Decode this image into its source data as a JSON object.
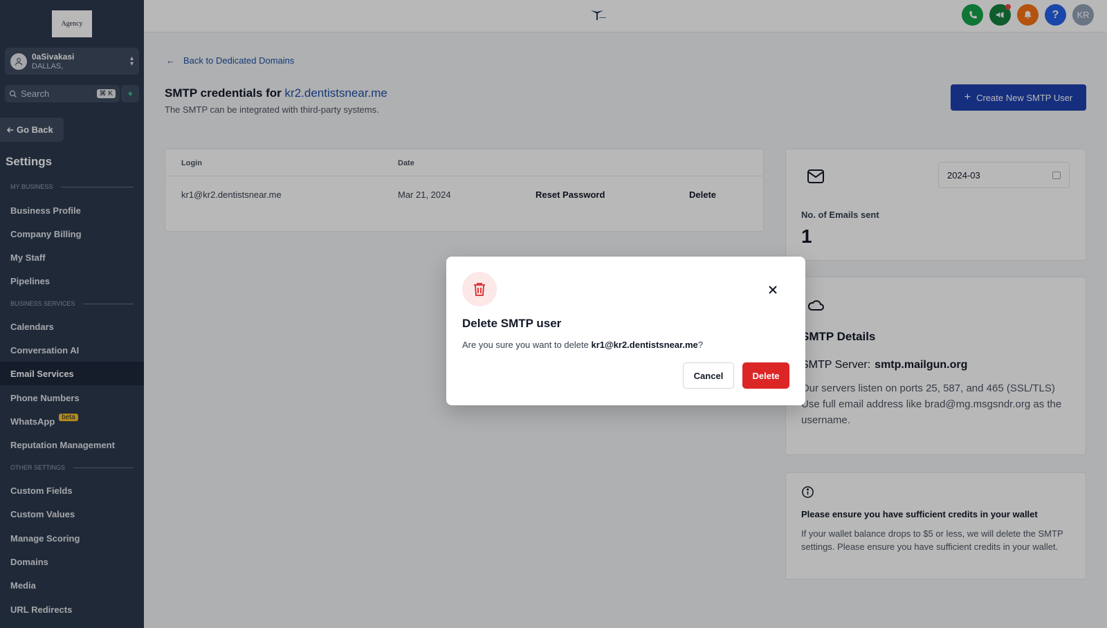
{
  "sidebar": {
    "logo_text": "Agency",
    "location": {
      "name": "0aSivakasi",
      "city": "DALLAS,"
    },
    "search": {
      "label": "Search",
      "shortcut": "⌘ K"
    },
    "go_back": "Go Back",
    "settings_title": "Settings",
    "sections": {
      "my_business": "MY BUSINESS",
      "business_services": "BUSINESS SERVICES",
      "other_settings": "OTHER SETTINGS"
    },
    "items": {
      "business_profile": "Business Profile",
      "company_billing": "Company Billing",
      "my_staff": "My Staff",
      "pipelines": "Pipelines",
      "calendars": "Calendars",
      "conversation_ai": "Conversation AI",
      "email_services": "Email Services",
      "phone_numbers": "Phone Numbers",
      "whatsapp": "WhatsApp",
      "whatsapp_badge": "beta",
      "reputation_management": "Reputation Management",
      "custom_fields": "Custom Fields",
      "custom_values": "Custom Values",
      "manage_scoring": "Manage Scoring",
      "domains": "Domains",
      "media": "Media",
      "url_redirects": "URL Redirects"
    }
  },
  "topbar": {
    "icons": [
      "phone-icon",
      "megaphone-icon",
      "bell-icon",
      "help-icon"
    ],
    "help_glyph": "?",
    "avatar_initials": "KR",
    "colors": {
      "phone": "#16a34a",
      "megaphone": "#15803d",
      "bell": "#f97316",
      "help": "#2563eb",
      "avatar": "#94a3b8"
    }
  },
  "main": {
    "back_link": "Back to Dedicated Domains",
    "title_prefix": "SMTP credentials for",
    "title_domain": "kr2.dentistsnear.me",
    "subtitle": "The SMTP can be integrated with third-party systems.",
    "create_button": "Create New SMTP User",
    "table": {
      "columns": {
        "login": "Login",
        "date": "Date"
      },
      "rows": [
        {
          "login": "kr1@kr2.dentistsnear.me",
          "date": "Mar 21, 2024",
          "reset": "Reset Password",
          "delete": "Delete"
        }
      ]
    },
    "stats": {
      "month_value": "2024-03",
      "emails_label": "No. of Emails sent",
      "emails_count": "1"
    },
    "smtp_details": {
      "title": "SMTP Details",
      "server_label": "SMTP Server:",
      "server_value": "smtp.mailgun.org",
      "ports_text": "Our servers listen on ports 25, 587, and 465 (SSL/TLS)",
      "username_text": "Use full email address like brad@mg.msgsndr.org as the username."
    },
    "credits": {
      "title": "Please ensure you have sufficient credits in your wallet",
      "text": "If your wallet balance drops to $5 or less, we will delete the SMTP settings. Please ensure you have sufficient credits in your wallet."
    }
  },
  "modal": {
    "title": "Delete SMTP user",
    "message_prefix": "Are you sure you want to delete",
    "message_email": "kr1@kr2.dentistsnear.me",
    "message_suffix": "?",
    "cancel": "Cancel",
    "delete": "Delete",
    "accent_color": "#dc2626"
  }
}
